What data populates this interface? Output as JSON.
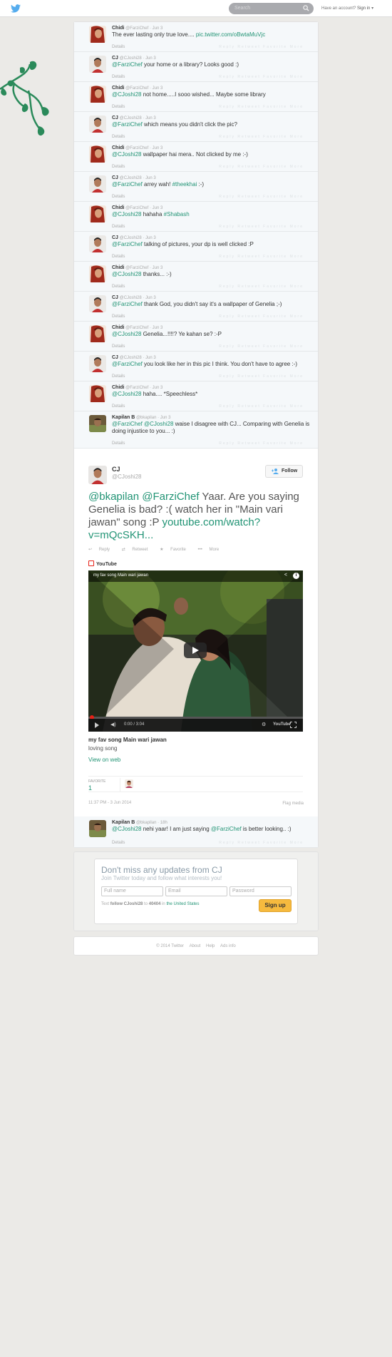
{
  "topbar": {
    "search_placeholder": "Search",
    "have_account": "Have an account?",
    "sign_in": "Sign in"
  },
  "tweets": [
    {
      "name": "Chidi",
      "handle": "@FarziChef",
      "time": "Jun 3",
      "text": "The ever lasting only true love.... ",
      "link": "pic.twitter.com/oBwtaMuVjc",
      "details": "Details",
      "avatar": "chidi"
    },
    {
      "name": "CJ",
      "handle": "@CJoshi28",
      "time": "Jun 3",
      "mention": "@FarziChef",
      "text": " your home or a library? Looks good :)",
      "details": "Details",
      "avatar": "cj"
    },
    {
      "name": "Chidi",
      "handle": "@FarziChef",
      "time": "Jun 3",
      "mention": "@CJoshi28",
      "text": " not home.....I sooo wished... Maybe some library",
      "details": "Details",
      "avatar": "chidi"
    },
    {
      "name": "CJ",
      "handle": "@CJoshi28",
      "time": "Jun 3",
      "mention": "@FarziChef",
      "text": " which means you didn't click the pic?",
      "details": "Details",
      "avatar": "cj"
    },
    {
      "name": "Chidi",
      "handle": "@FarziChef",
      "time": "Jun 3",
      "mention": "@CJoshi28",
      "text": " wallpaper hai mera.. Not clicked by me :-)",
      "details": "Details",
      "avatar": "chidi"
    },
    {
      "name": "CJ",
      "handle": "@CJoshi28",
      "time": "Jun 3",
      "mention": "@FarziChef",
      "text": " arrey wah! ",
      "tag": "#theekhai",
      "tail": " :-)",
      "details": "Details",
      "avatar": "cj"
    },
    {
      "name": "Chidi",
      "handle": "@FarziChef",
      "time": "Jun 3",
      "mention": "@CJoshi28",
      "text": " hahaha ",
      "tag": "#Shabash",
      "details": "Details",
      "avatar": "chidi"
    },
    {
      "name": "CJ",
      "handle": "@CJoshi28",
      "time": "Jun 3",
      "mention": "@FarziChef",
      "text": " talking of pictures, your dp is well clicked :P",
      "details": "Details",
      "avatar": "cj"
    },
    {
      "name": "Chidi",
      "handle": "@FarziChef",
      "time": "Jun 3",
      "mention": "@CJoshi28",
      "text": " thanks... :-)",
      "details": "Details",
      "avatar": "chidi"
    },
    {
      "name": "CJ",
      "handle": "@CJoshi28",
      "time": "Jun 3",
      "mention": "@FarziChef",
      "text": " thank God, you didn't say it's a wallpaper of Genelia ;-)",
      "details": "Details",
      "avatar": "cj"
    },
    {
      "name": "Chidi",
      "handle": "@FarziChef",
      "time": "Jun 3",
      "mention": "@CJoshi28",
      "text": " Genelia...!!!!? Ye kahan se? :-P",
      "details": "Details",
      "avatar": "chidi"
    },
    {
      "name": "CJ",
      "handle": "@CJoshi28",
      "time": "Jun 3",
      "mention": "@FarziChef",
      "text": " you look like her in this pic I think. You don't have to agree :-)",
      "details": "Details",
      "avatar": "cj"
    },
    {
      "name": "Chidi",
      "handle": "@FarziChef",
      "time": "Jun 3",
      "mention": "@CJoshi28",
      "text": " haha.... *Speechless*",
      "details": "Details",
      "avatar": "chidi"
    },
    {
      "name": "Kapilan B",
      "handle": "@bkapilan",
      "time": "Jun 3",
      "mention": "@FarziChef",
      "mention2": "@CJoshi28",
      "text": " waise I disagree with CJ... Comparing with Genelia is doing injustice to you... :)",
      "details": "Details",
      "avatar": "kapilan"
    }
  ],
  "actions_faded": "Reply   Retweet   Favorite   More",
  "main_tweet": {
    "name": "CJ",
    "handle": "@CJoshi28",
    "follow": "Follow",
    "mention1": "@bkapilan",
    "mention2": "@FarziChef",
    "text": " Yaar. Are you saying Genelia is bad? :( watch her in \"Main vari jawan\" song :P ",
    "link": "youtube.com/watch?v=mQcSKH...",
    "actions": [
      "Reply",
      "Retweet",
      "Favorite",
      "More"
    ],
    "card_source": "YouTube",
    "video_title": "my fav song Main wari jawan",
    "video_time": "0:00 / 3:04",
    "video_brand": "YouTube",
    "caption_title": "my fav song Main wari jawan",
    "caption_desc": "loving song",
    "view_on_web": "View on web",
    "favorites_label": "FAVORITE",
    "favorites_count": "1",
    "timestamp": "11:37 PM - 3 Jun 2014",
    "flag_media": "Flag media"
  },
  "reply": {
    "name": "Kapilan B",
    "handle": "@bkapilan",
    "time": "18h",
    "mention": "@CJoshi28",
    "text": " nehi yaar! I am just saying ",
    "mention2": "@FarziChef",
    "tail": " is better looking.. :)",
    "details": "Details"
  },
  "signup": {
    "heading": "Don't miss any updates from CJ",
    "sub": "Join Twitter today and follow what interests you!",
    "fullname": "Full name",
    "email": "Email",
    "password": "Password",
    "sms_text": "Text",
    "sms_cmd": "follow CJoshi28",
    "sms_to": "to",
    "sms_num": "40404",
    "sms_in": "in",
    "sms_country": "the United States",
    "button": "Sign up"
  },
  "footer": [
    "© 2014 Twitter",
    "About",
    "Help",
    "Ads info"
  ],
  "colors": {
    "link": "#229475",
    "signup_button": "#f6ba3e",
    "page_bg": "#ebeae7"
  }
}
